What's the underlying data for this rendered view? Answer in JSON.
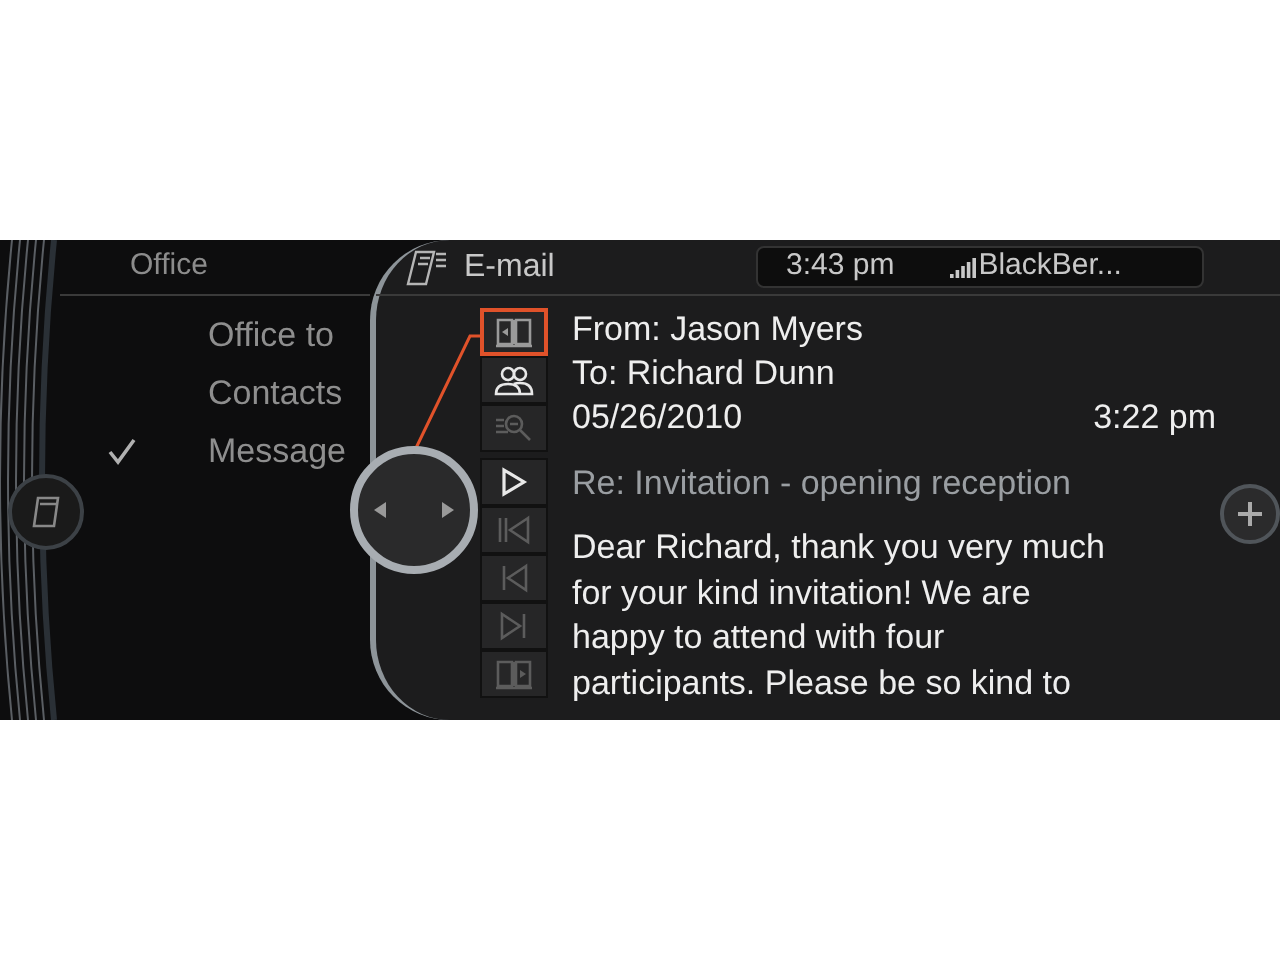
{
  "sidebar": {
    "title": "Office",
    "items": [
      {
        "label": "Office to",
        "checked": false
      },
      {
        "label": "Contacts",
        "checked": false
      },
      {
        "label": "Message",
        "checked": true
      }
    ]
  },
  "header": {
    "title": "E-mail",
    "time": "3:43 pm",
    "device": "BlackBer..."
  },
  "toolbar": [
    {
      "kind": "read",
      "selected": true,
      "disabled": false
    },
    {
      "kind": "contacts",
      "selected": false,
      "disabled": false
    },
    {
      "kind": "search",
      "selected": false,
      "disabled": true
    },
    {
      "kind": "play",
      "selected": false,
      "disabled": false
    },
    {
      "kind": "first",
      "selected": false,
      "disabled": true
    },
    {
      "kind": "previous",
      "selected": false,
      "disabled": true
    },
    {
      "kind": "next",
      "selected": false,
      "disabled": true
    },
    {
      "kind": "book-play",
      "selected": false,
      "disabled": true
    }
  ],
  "message": {
    "from": "From: Jason Myers",
    "to": "To: Richard Dunn",
    "date": "05/26/2010",
    "time": "3:22 pm",
    "subject": "Re: Invitation - opening reception",
    "body_lines": [
      "Dear Richard, thank you very much",
      "for your kind invitation! We are",
      "happy to attend with four",
      "participants. Please be so kind to"
    ]
  }
}
